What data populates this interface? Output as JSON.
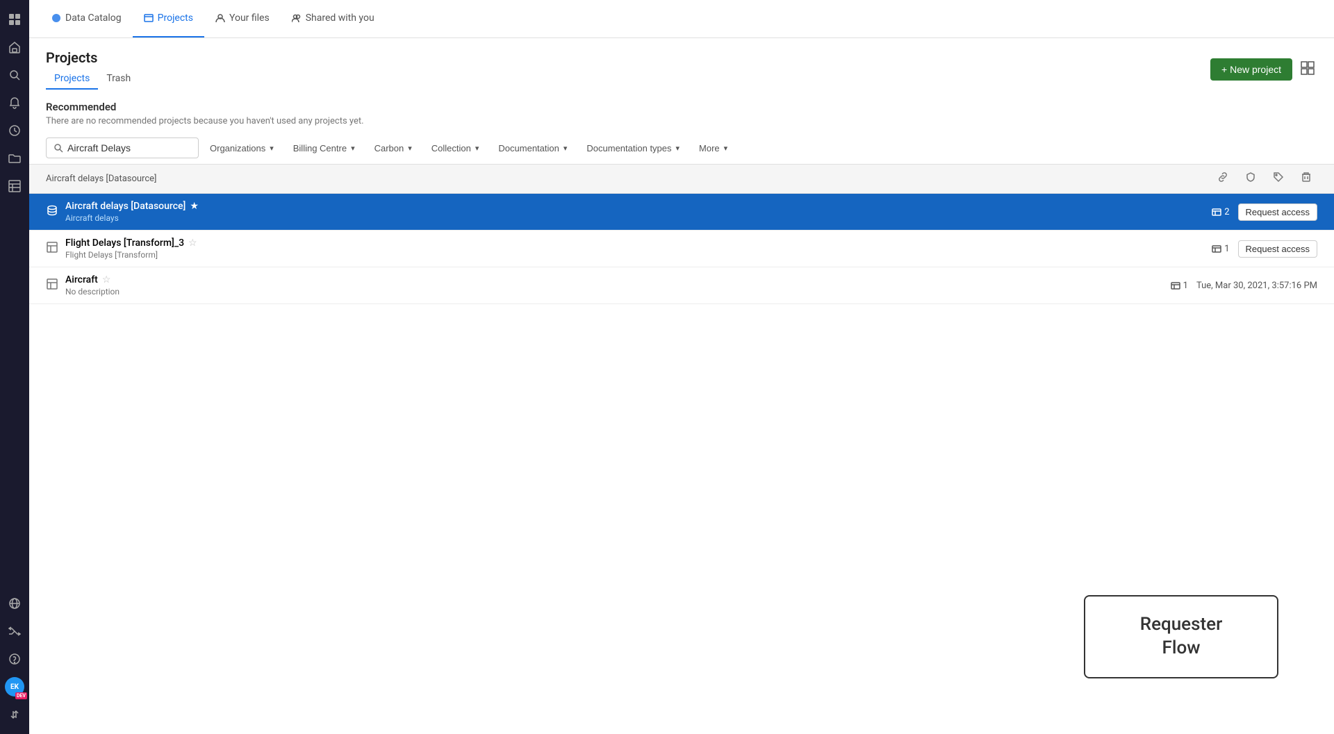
{
  "sidebar": {
    "icons": [
      {
        "name": "grid-icon",
        "symbol": "⊞",
        "active": false
      },
      {
        "name": "home-icon",
        "symbol": "⌂",
        "active": false
      },
      {
        "name": "search-icon",
        "symbol": "⌕",
        "active": false
      },
      {
        "name": "bell-icon",
        "symbol": "🔔",
        "active": false
      },
      {
        "name": "clock-icon",
        "symbol": "⏱",
        "active": false
      },
      {
        "name": "folder-icon",
        "symbol": "📁",
        "active": false
      },
      {
        "name": "table-icon",
        "symbol": "▦",
        "active": false
      }
    ],
    "bottom_icons": [
      {
        "name": "globe-icon",
        "symbol": "🌐"
      },
      {
        "name": "shuffle-icon",
        "symbol": "⇌"
      },
      {
        "name": "help-icon",
        "symbol": "?"
      }
    ],
    "avatar_label": "EK",
    "avatar_badge": "DEV",
    "expand_icon": "↗"
  },
  "top_nav": {
    "tabs": [
      {
        "label": "Data Catalog",
        "icon": "●",
        "active": false
      },
      {
        "label": "Projects",
        "icon": "📋",
        "active": true
      },
      {
        "label": "Your files",
        "icon": "👤",
        "active": false
      },
      {
        "label": "Shared with you",
        "icon": "👥",
        "active": false
      }
    ]
  },
  "page": {
    "title": "Projects",
    "sub_tabs": [
      {
        "label": "Projects",
        "active": true
      },
      {
        "label": "Trash",
        "active": false
      }
    ],
    "new_project_label": "+ New project",
    "recommended": {
      "title": "Recommended",
      "desc": "There are no recommended projects because you haven't used any projects yet."
    },
    "search": {
      "placeholder": "",
      "value": "Aircraft Delays"
    },
    "filters": [
      {
        "label": "Organizations",
        "name": "organizations-filter"
      },
      {
        "label": "Billing Centre",
        "name": "billing-centre-filter"
      },
      {
        "label": "Carbon",
        "name": "carbon-filter"
      },
      {
        "label": "Collection",
        "name": "collection-filter"
      },
      {
        "label": "Documentation",
        "name": "documentation-filter"
      },
      {
        "label": "Documentation types",
        "name": "documentation-types-filter"
      },
      {
        "label": "More",
        "name": "more-filter"
      }
    ],
    "results_header": "Aircraft delays [Datasource]",
    "rows": [
      {
        "id": "row-1",
        "icon": "🗄",
        "title": "Aircraft delays [Datasource]",
        "subtitle": "Aircraft delays",
        "starred": true,
        "count": "2",
        "action": "Request access",
        "selected": true
      },
      {
        "id": "row-2",
        "icon": "⬜",
        "title": "Flight Delays [Transform]_3",
        "subtitle": "Flight Delays [Transform]",
        "starred": false,
        "count": "1",
        "action": "Request access",
        "selected": false
      },
      {
        "id": "row-3",
        "icon": "⬜",
        "title": "Aircraft",
        "subtitle": "No description",
        "starred": false,
        "count": "1",
        "date": "Tue, Mar 30, 2021, 3:57:16 PM",
        "action": null,
        "selected": false
      }
    ]
  },
  "requester_flow": {
    "label": "Requester\nFlow"
  }
}
